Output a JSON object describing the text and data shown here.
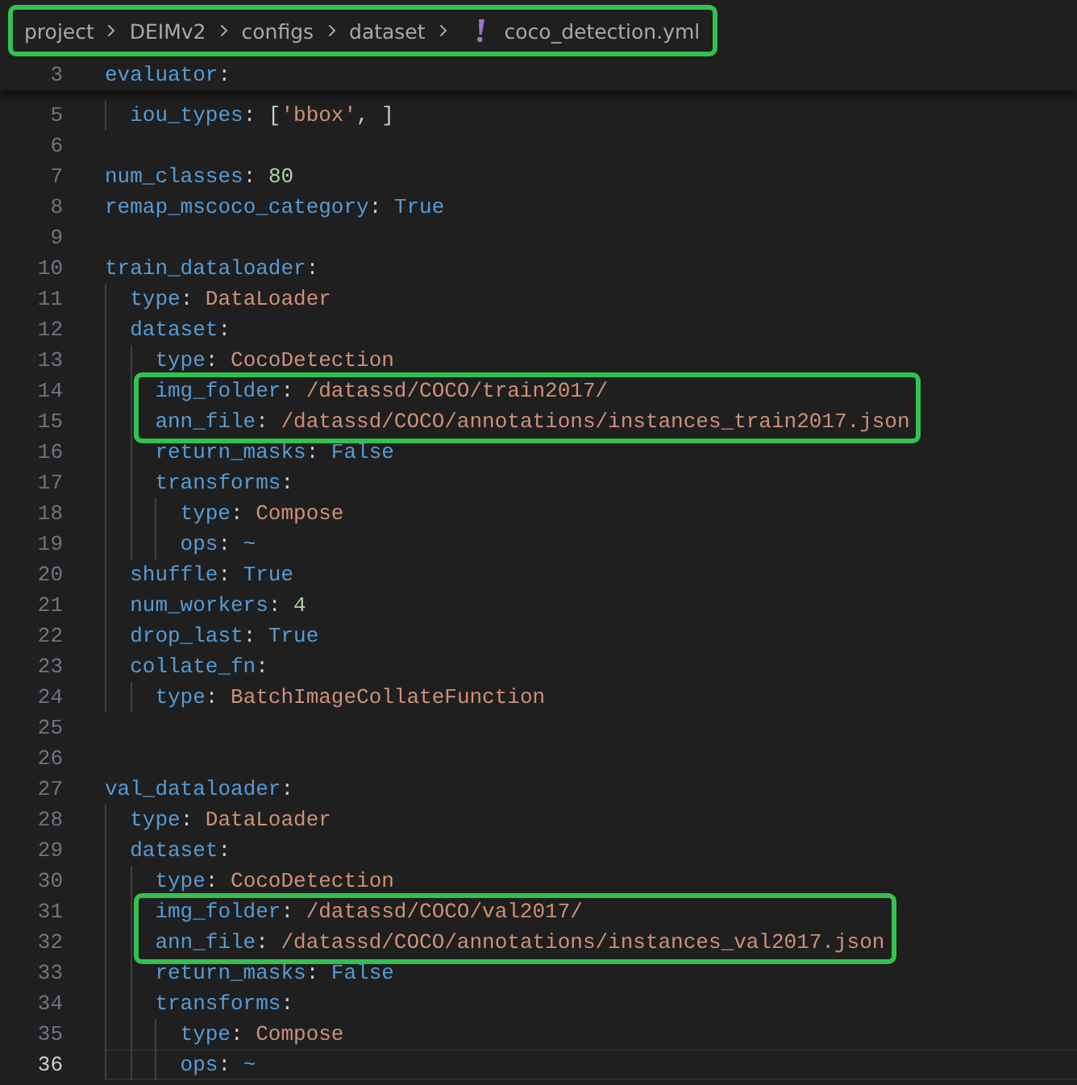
{
  "breadcrumb": {
    "boxed": true,
    "folders": [
      "project",
      "DEIMv2",
      "configs",
      "dataset"
    ],
    "file": "coco_detection.yml"
  },
  "lines": [
    {
      "n": "3",
      "sticky": true,
      "tokens": [
        {
          "kind": "key",
          "text": "evaluator"
        },
        {
          "kind": "punct",
          "text": ":"
        }
      ],
      "children": [
        {
          "n": "5",
          "tokens": [
            {
              "kind": "key",
              "text": "iou_types"
            },
            {
              "kind": "punct",
              "text": ": ["
            },
            {
              "kind": "string",
              "text": "'bbox'"
            },
            {
              "kind": "punct",
              "text": ", ]"
            }
          ]
        }
      ]
    },
    {
      "n": "6"
    },
    {
      "n": "7",
      "tokens": [
        {
          "kind": "key",
          "text": "num_classes"
        },
        {
          "kind": "punct",
          "text": ": "
        },
        {
          "kind": "number",
          "text": "80"
        }
      ]
    },
    {
      "n": "8",
      "tokens": [
        {
          "kind": "key",
          "text": "remap_mscoco_category"
        },
        {
          "kind": "punct",
          "text": ": "
        },
        {
          "kind": "constant",
          "text": "True"
        }
      ]
    },
    {
      "n": "9"
    },
    {
      "n": "10",
      "tokens": [
        {
          "kind": "key",
          "text": "train_dataloader"
        },
        {
          "kind": "punct",
          "text": ":"
        }
      ],
      "children": [
        {
          "n": "11",
          "tokens": [
            {
              "kind": "key",
              "text": "type"
            },
            {
              "kind": "punct",
              "text": ": "
            },
            {
              "kind": "string",
              "text": "DataLoader"
            }
          ]
        },
        {
          "n": "12",
          "tokens": [
            {
              "kind": "key",
              "text": "dataset"
            },
            {
              "kind": "punct",
              "text": ":"
            }
          ],
          "children": [
            {
              "n": "13",
              "tokens": [
                {
                  "kind": "key",
                  "text": "type"
                },
                {
                  "kind": "punct",
                  "text": ": "
                },
                {
                  "kind": "string",
                  "text": "CocoDetection"
                }
              ]
            },
            {
              "n": "14",
              "boxed": true,
              "tokens": [
                {
                  "kind": "key",
                  "text": "img_folder"
                },
                {
                  "kind": "punct",
                  "text": ": "
                },
                {
                  "kind": "string",
                  "text": "/datassd/COCO/train2017/"
                }
              ]
            },
            {
              "n": "15",
              "boxed": true,
              "tokens": [
                {
                  "kind": "key",
                  "text": "ann_file"
                },
                {
                  "kind": "punct",
                  "text": ": "
                },
                {
                  "kind": "string",
                  "text": "/datassd/COCO/annotations/instances_train2017.json"
                }
              ]
            },
            {
              "n": "16",
              "tokens": [
                {
                  "kind": "key",
                  "text": "return_masks"
                },
                {
                  "kind": "punct",
                  "text": ": "
                },
                {
                  "kind": "constant",
                  "text": "False"
                }
              ]
            },
            {
              "n": "17",
              "tokens": [
                {
                  "kind": "key",
                  "text": "transforms"
                },
                {
                  "kind": "punct",
                  "text": ":"
                }
              ],
              "children": [
                {
                  "n": "18",
                  "tokens": [
                    {
                      "kind": "key",
                      "text": "type"
                    },
                    {
                      "kind": "punct",
                      "text": ": "
                    },
                    {
                      "kind": "string",
                      "text": "Compose"
                    }
                  ]
                },
                {
                  "n": "19",
                  "tokens": [
                    {
                      "kind": "key",
                      "text": "ops"
                    },
                    {
                      "kind": "punct",
                      "text": ": "
                    },
                    {
                      "kind": "constant",
                      "text": "~"
                    }
                  ]
                }
              ]
            }
          ]
        },
        {
          "n": "20",
          "tokens": [
            {
              "kind": "key",
              "text": "shuffle"
            },
            {
              "kind": "punct",
              "text": ": "
            },
            {
              "kind": "constant",
              "text": "True"
            }
          ]
        },
        {
          "n": "21",
          "tokens": [
            {
              "kind": "key",
              "text": "num_workers"
            },
            {
              "kind": "punct",
              "text": ": "
            },
            {
              "kind": "number",
              "text": "4"
            }
          ]
        },
        {
          "n": "22",
          "tokens": [
            {
              "kind": "key",
              "text": "drop_last"
            },
            {
              "kind": "punct",
              "text": ": "
            },
            {
              "kind": "constant",
              "text": "True"
            }
          ]
        },
        {
          "n": "23",
          "tokens": [
            {
              "kind": "key",
              "text": "collate_fn"
            },
            {
              "kind": "punct",
              "text": ":"
            }
          ],
          "children": [
            {
              "n": "24",
              "tokens": [
                {
                  "kind": "key",
                  "text": "type"
                },
                {
                  "kind": "punct",
                  "text": ": "
                },
                {
                  "kind": "string",
                  "text": "BatchImageCollateFunction"
                }
              ]
            }
          ]
        }
      ]
    },
    {
      "n": "25"
    },
    {
      "n": "26"
    },
    {
      "n": "27",
      "tokens": [
        {
          "kind": "key",
          "text": "val_dataloader"
        },
        {
          "kind": "punct",
          "text": ":"
        }
      ],
      "children": [
        {
          "n": "28",
          "tokens": [
            {
              "kind": "key",
              "text": "type"
            },
            {
              "kind": "punct",
              "text": ": "
            },
            {
              "kind": "string",
              "text": "DataLoader"
            }
          ]
        },
        {
          "n": "29",
          "tokens": [
            {
              "kind": "key",
              "text": "dataset"
            },
            {
              "kind": "punct",
              "text": ":"
            }
          ],
          "children": [
            {
              "n": "30",
              "tokens": [
                {
                  "kind": "key",
                  "text": "type"
                },
                {
                  "kind": "punct",
                  "text": ": "
                },
                {
                  "kind": "string",
                  "text": "CocoDetection"
                }
              ]
            },
            {
              "n": "31",
              "boxed": true,
              "tokens": [
                {
                  "kind": "key",
                  "text": "img_folder"
                },
                {
                  "kind": "punct",
                  "text": ": "
                },
                {
                  "kind": "string",
                  "text": "/datassd/COCO/val2017/"
                }
              ]
            },
            {
              "n": "32",
              "boxed": true,
              "tokens": [
                {
                  "kind": "key",
                  "text": "ann_file"
                },
                {
                  "kind": "punct",
                  "text": ": "
                },
                {
                  "kind": "string",
                  "text": "/datassd/COCO/annotations/instances_val2017.json"
                }
              ]
            },
            {
              "n": "33",
              "tokens": [
                {
                  "kind": "key",
                  "text": "return_masks"
                },
                {
                  "kind": "punct",
                  "text": ": "
                },
                {
                  "kind": "constant",
                  "text": "False"
                }
              ]
            },
            {
              "n": "34",
              "tokens": [
                {
                  "kind": "key",
                  "text": "transforms"
                },
                {
                  "kind": "punct",
                  "text": ":"
                }
              ],
              "children": [
                {
                  "n": "35",
                  "tokens": [
                    {
                      "kind": "key",
                      "text": "type"
                    },
                    {
                      "kind": "punct",
                      "text": ": "
                    },
                    {
                      "kind": "string",
                      "text": "Compose"
                    }
                  ]
                },
                {
                  "n": "36",
                  "current": true,
                  "tokens": [
                    {
                      "kind": "key",
                      "text": "ops"
                    },
                    {
                      "kind": "punct",
                      "text": ": "
                    },
                    {
                      "kind": "constant",
                      "text": "~"
                    }
                  ]
                }
              ]
            }
          ]
        }
      ]
    }
  ]
}
